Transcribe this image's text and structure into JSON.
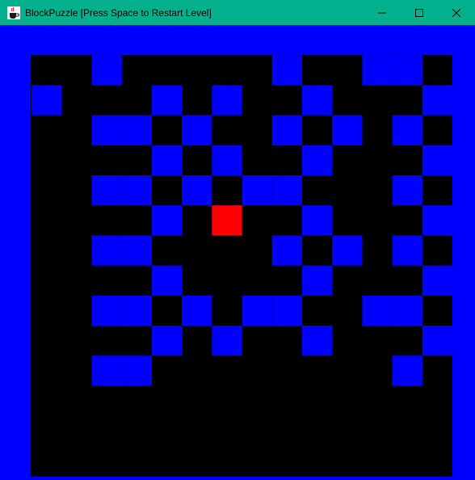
{
  "window": {
    "title": "BlockPuzzle [Press Space to Restart Level]",
    "app_icon": "java-coffee-cup-icon",
    "controls": [
      "minimize-icon",
      "maximize-icon",
      "close-icon"
    ]
  },
  "colors": {
    "titlebar": "#03b08e",
    "wall": "#0000ff",
    "floor": "#000000",
    "player": "#ff0000"
  },
  "game": {
    "walls": [
      [
        2,
        2
      ],
      [
        4,
        1
      ],
      [
        4,
        3
      ],
      [
        4,
        5
      ],
      [
        4,
        7
      ],
      [
        4,
        9
      ],
      [
        4,
        11
      ],
      [
        5,
        3
      ],
      [
        5,
        5
      ],
      [
        5,
        7
      ],
      [
        5,
        9
      ],
      [
        5,
        11
      ],
      [
        6,
        2
      ],
      [
        6,
        4
      ],
      [
        6,
        6
      ],
      [
        6,
        8
      ],
      [
        6,
        10
      ],
      [
        7,
        3
      ],
      [
        7,
        5
      ],
      [
        7,
        9
      ],
      [
        8,
        2
      ],
      [
        8,
        4
      ],
      [
        8,
        6
      ],
      [
        8,
        10
      ],
      [
        9,
        5
      ],
      [
        9,
        9
      ],
      [
        10,
        1
      ],
      [
        10,
        3
      ],
      [
        10,
        5
      ],
      [
        10,
        7
      ],
      [
        10,
        9
      ],
      [
        11,
        2
      ],
      [
        11,
        4
      ],
      [
        11,
        6
      ],
      [
        11,
        8
      ],
      [
        11,
        10
      ],
      [
        12,
        3
      ],
      [
        12,
        7
      ],
      [
        13,
        1
      ],
      [
        13,
        9
      ],
      [
        14,
        1
      ],
      [
        14,
        3
      ],
      [
        14,
        5
      ],
      [
        14,
        7
      ],
      [
        14,
        9
      ],
      [
        14,
        11
      ],
      [
        15,
        2
      ],
      [
        15,
        4
      ],
      [
        15,
        6
      ],
      [
        15,
        8
      ],
      [
        15,
        10
      ]
    ],
    "player": [
      7,
      6
    ]
  }
}
